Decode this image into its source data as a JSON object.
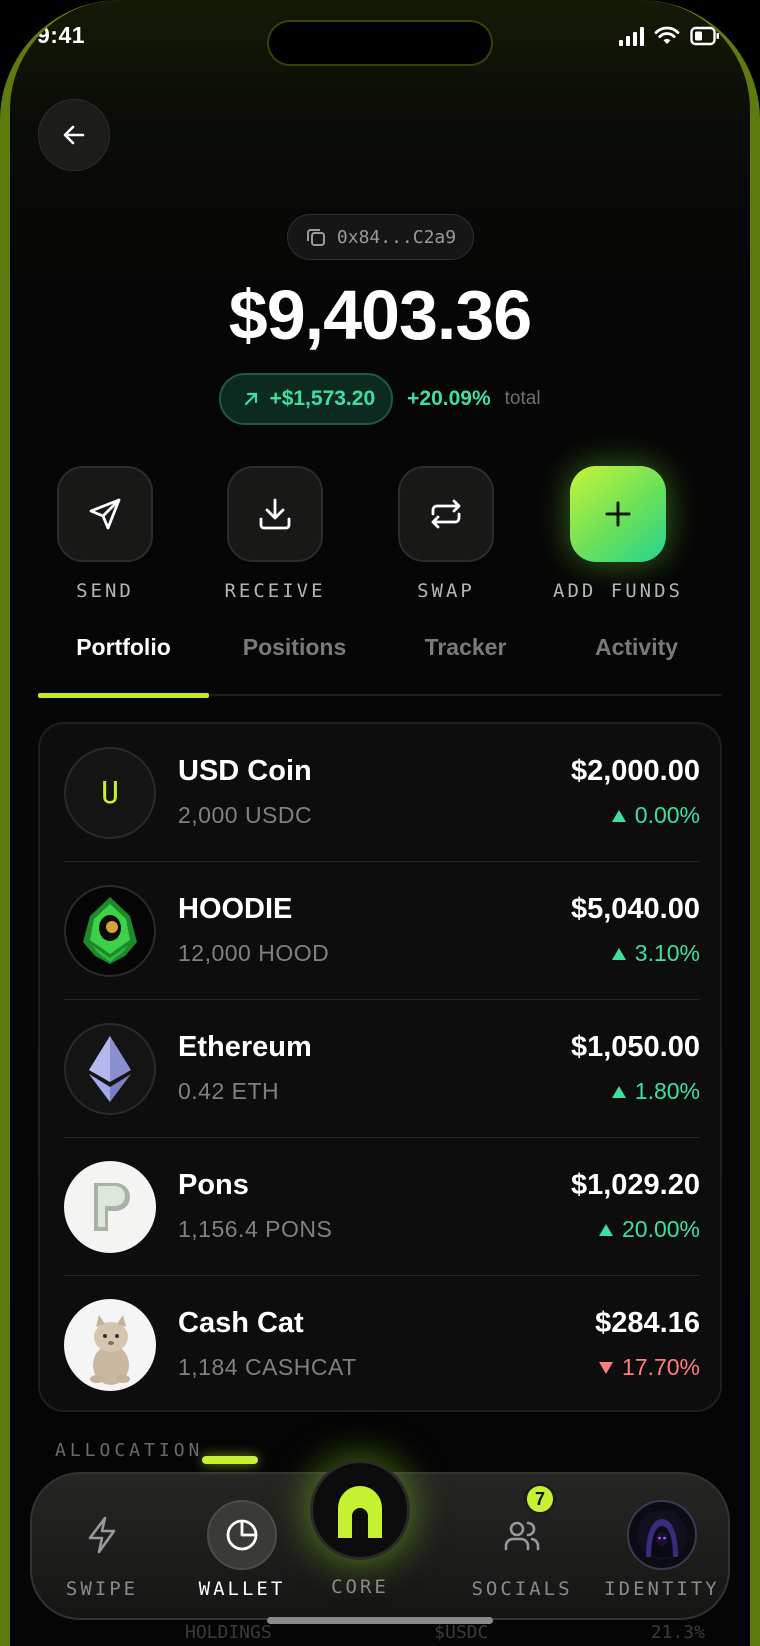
{
  "status": {
    "time": "9:41"
  },
  "wallet": {
    "address": "0x84...C2a9",
    "balance": "$9,403.36",
    "change_amount": "+$1,573.20",
    "change_pct": "+20.09%",
    "change_suffix": "total"
  },
  "actions": [
    {
      "label": "SEND",
      "icon": "send-icon"
    },
    {
      "label": "RECEIVE",
      "icon": "download-icon"
    },
    {
      "label": "SWAP",
      "icon": "swap-icon"
    },
    {
      "label": "ADD FUNDS",
      "icon": "plus-icon"
    }
  ],
  "tabs": [
    {
      "label": "Portfolio",
      "active": true
    },
    {
      "label": "Positions",
      "active": false
    },
    {
      "label": "Tracker",
      "active": false
    },
    {
      "label": "Activity",
      "active": false
    }
  ],
  "holdings": [
    {
      "name": "USD Coin",
      "amount": "2,000 USDC",
      "value": "$2,000.00",
      "change": "0.00%",
      "direction": "up",
      "avatar_letter": "U"
    },
    {
      "name": "HOODIE",
      "amount": "12,000 HOOD",
      "value": "$5,040.00",
      "change": "3.10%",
      "direction": "up"
    },
    {
      "name": "Ethereum",
      "amount": "0.42 ETH",
      "value": "$1,050.00",
      "change": "1.80%",
      "direction": "up"
    },
    {
      "name": "Pons",
      "amount": "1,156.4 PONS",
      "value": "$1,029.20",
      "change": "20.00%",
      "direction": "up"
    },
    {
      "name": "Cash Cat",
      "amount": "1,184 CASHCAT",
      "value": "$284.16",
      "change": "17.70%",
      "direction": "down"
    }
  ],
  "allocation_label": "ALLOCATION",
  "holdings_ghost": {
    "label": "HOLDINGS",
    "token": "$USDC",
    "pct": "21.3%"
  },
  "nav": {
    "items": [
      {
        "label": "SWIPE",
        "icon": "lightning-icon"
      },
      {
        "label": "WALLET",
        "icon": "pie-chart-icon",
        "active": true
      },
      {
        "label": "CORE",
        "icon": "core-arch-icon"
      },
      {
        "label": "SOCIALS",
        "icon": "users-icon",
        "badge": "7"
      },
      {
        "label": "IDENTITY",
        "icon": "hooded-avatar-icon"
      }
    ]
  },
  "colors": {
    "accent": "#c6f032",
    "positive": "#3ee0a0",
    "negative": "#ff7d7d"
  }
}
